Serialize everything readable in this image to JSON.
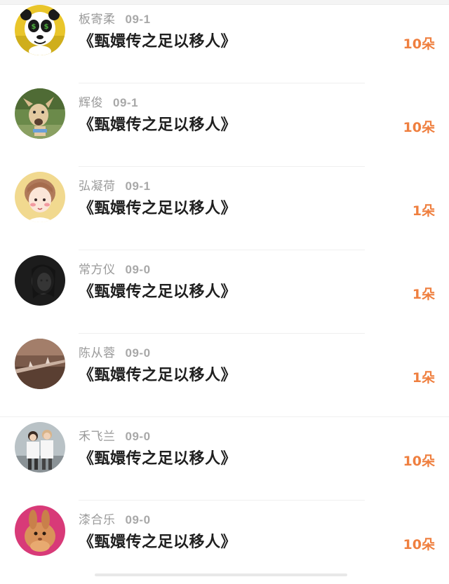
{
  "rows": [
    {
      "name": "板寄柔",
      "date": "09-1",
      "title": "《甄嬛传之足以移人》",
      "amount": "10朵",
      "avatar_icon": "panda-avatar-icon"
    },
    {
      "name": "辉俊",
      "date": "09-1",
      "title": "《甄嬛传之足以移人》",
      "amount": "10朵",
      "avatar_icon": "dog-avatar-icon"
    },
    {
      "name": "弘凝荷",
      "date": "09-1",
      "title": "《甄嬛传之足以移人》",
      "amount": "1朵",
      "avatar_icon": "cartoon-girl-avatar-icon"
    },
    {
      "name": "常方仪",
      "date": "09-0",
      "title": "《甄嬛传之足以移人》",
      "amount": "1朵",
      "avatar_icon": "dark-portrait-avatar-icon"
    },
    {
      "name": "陈从蓉",
      "date": "09-0",
      "title": "《甄嬛传之足以移人》",
      "amount": "1朵",
      "avatar_icon": "branch-avatar-icon"
    },
    {
      "name": "禾飞兰",
      "date": "09-0",
      "title": "《甄嬛传之足以移人》",
      "amount": "10朵",
      "avatar_icon": "couple-avatar-icon"
    },
    {
      "name": "漆合乐",
      "date": "09-0",
      "title": "《甄嬛传之足以移人》",
      "amount": "10朵",
      "avatar_icon": "rabbit-avatar-icon"
    }
  ],
  "colors": {
    "accent": "#ef7f3f",
    "name_text": "#9a9a9a",
    "title_text": "#1f1f1f"
  }
}
